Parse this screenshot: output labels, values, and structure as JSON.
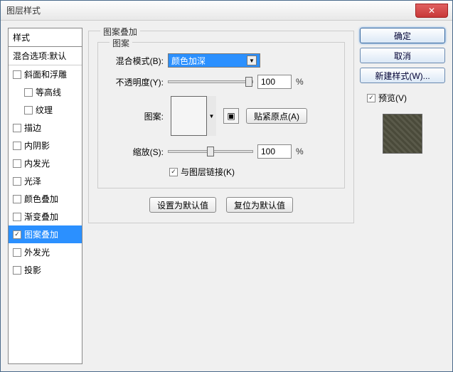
{
  "window": {
    "title": "图层样式"
  },
  "left": {
    "header": "样式",
    "subheader": "混合选项:默认",
    "items": [
      {
        "label": "斜面和浮雕",
        "checked": false,
        "indent": false
      },
      {
        "label": "等高线",
        "checked": false,
        "indent": true
      },
      {
        "label": "纹理",
        "checked": false,
        "indent": true
      },
      {
        "label": "描边",
        "checked": false,
        "indent": false
      },
      {
        "label": "内阴影",
        "checked": false,
        "indent": false
      },
      {
        "label": "内发光",
        "checked": false,
        "indent": false
      },
      {
        "label": "光泽",
        "checked": false,
        "indent": false
      },
      {
        "label": "颜色叠加",
        "checked": false,
        "indent": false
      },
      {
        "label": "渐变叠加",
        "checked": false,
        "indent": false
      },
      {
        "label": "图案叠加",
        "checked": true,
        "indent": false,
        "selected": true
      },
      {
        "label": "外发光",
        "checked": false,
        "indent": false
      },
      {
        "label": "投影",
        "checked": false,
        "indent": false
      }
    ]
  },
  "center": {
    "section_title": "图案叠加",
    "group_title": "图案",
    "blend_mode_label": "混合模式(B):",
    "blend_mode_value": "颜色加深",
    "opacity_label": "不透明度(Y):",
    "opacity_value": "100",
    "opacity_unit": "%",
    "pattern_label": "图案:",
    "snap_button": "贴紧原点(A)",
    "scale_label": "缩放(S):",
    "scale_value": "100",
    "scale_unit": "%",
    "link_label": "与图层链接(K)",
    "link_checked": true,
    "make_default": "设置为默认值",
    "reset_default": "复位为默认值"
  },
  "right": {
    "ok": "确定",
    "cancel": "取消",
    "new_style": "新建样式(W)...",
    "preview_label": "预览(V)",
    "preview_checked": true
  }
}
